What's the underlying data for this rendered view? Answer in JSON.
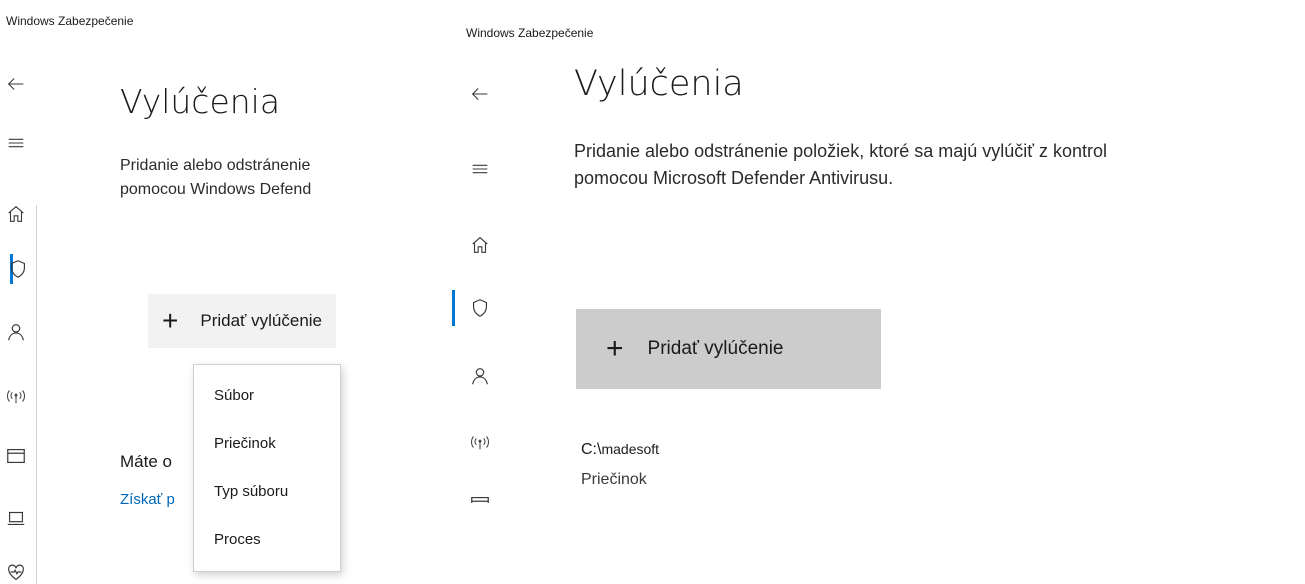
{
  "window_title": "Windows Zabezpečenie",
  "page": {
    "title": "Vylúčenia",
    "description_left": "Pridanie alebo odstránenie položiek, ktoré sa majú vylúčiť z kontrol pomocou Windows Defender Antivirusu.",
    "description_right_line1": "Pridanie alebo odstránenie položiek, ktoré sa majú vylúčiť z kontrol",
    "description_right_line2": "pomocou Microsoft Defender Antivirusu.",
    "add_button": {
      "icon": "plus-icon",
      "label": "Pridať vylúčenie"
    }
  },
  "left_panel": {
    "description_line1": "Pridanie alebo odstránenie",
    "description_line2": "pomocou Windows Defend",
    "dropdown_options": [
      "Súbor",
      "Priečinok",
      "Typ súboru",
      "Proces"
    ],
    "help_heading": "Máte o",
    "help_link": "Získať p"
  },
  "exclusions": [
    {
      "path_prefix": "C:\\",
      "path_rest": "madesoft",
      "type": "Priečinok"
    }
  ],
  "nav_icons": [
    "back-arrow-icon",
    "hamburger-icon",
    "home-icon",
    "shield-icon",
    "person-icon",
    "wireless-icon",
    "app-browser-icon",
    "device-icon",
    "health-heart-icon"
  ],
  "colors": {
    "accent": "#0078d4",
    "link": "#0067b8",
    "button_bg_left": "#f2f2f2",
    "button_bg_right": "#cccccc"
  }
}
